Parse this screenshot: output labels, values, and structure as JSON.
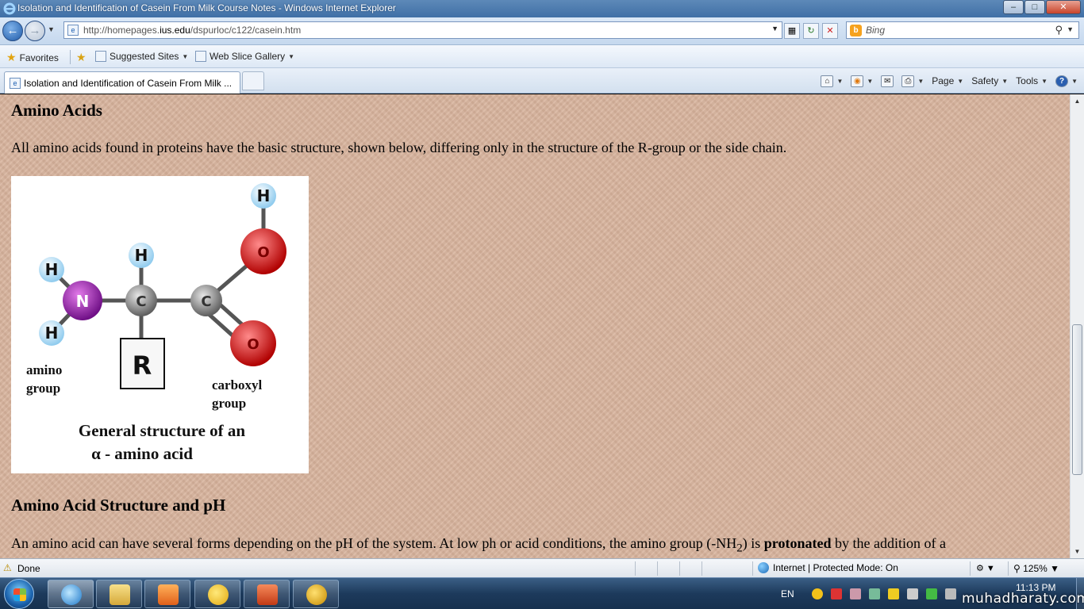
{
  "window": {
    "title": "Isolation and Identification of Casein From Milk Course Notes - Windows Internet Explorer",
    "minimize": "–",
    "maximize": "□",
    "close": "✕"
  },
  "address": {
    "url_prefix": "http://homepages.",
    "url_host": "ius.edu",
    "url_suffix": "/dspurloc/c122/casein.htm",
    "search_placeholder": "Bing"
  },
  "favorites": {
    "favorites_label": "Favorites",
    "suggested_label": "Suggested Sites",
    "webslice_label": "Web Slice Gallery"
  },
  "tabs": {
    "active_label": "Isolation and Identification of Casein From Milk ..."
  },
  "command_bar": {
    "page_label": "Page",
    "safety_label": "Safety",
    "tools_label": "Tools",
    "help_label": "?"
  },
  "content": {
    "heading1": "Amino Acids",
    "para1": "All amino acids found in proteins have the basic structure, shown below, differing only in the structure of the R-group or the side chain.",
    "figure": {
      "label_amino_1": "amino",
      "label_amino_2": "group",
      "label_carboxyl_1": "carboxyl",
      "label_carboxyl_2": "group",
      "caption_1": "General structure of an",
      "caption_2": "α - amino acid",
      "atom_h": "H",
      "atom_n": "N",
      "atom_c": "C",
      "atom_o": "O",
      "r_group": "R"
    },
    "heading2": "Amino Acid Structure and pH",
    "para2_a": "An amino acid can have several forms depending on the pH of the system. At low ph or acid conditions, the amino group (-NH",
    "para2_sub": "2",
    "para2_b": ") is ",
    "para2_bold": "protonated",
    "para2_c": " by the addition of a"
  },
  "status": {
    "done": "Done",
    "zone": "Internet | Protected Mode: On",
    "zoom": "125%"
  },
  "taskbar": {
    "lang": "EN",
    "time": "11:13 PM",
    "watermark": "muhadharaty.com"
  },
  "colors": {
    "page_bg": "#d7b39d",
    "nitrogen": "#8a1a9a",
    "oxygen": "#e01010",
    "hydrogen": "#bfe3f7",
    "carbon": "#8c8c8c"
  }
}
